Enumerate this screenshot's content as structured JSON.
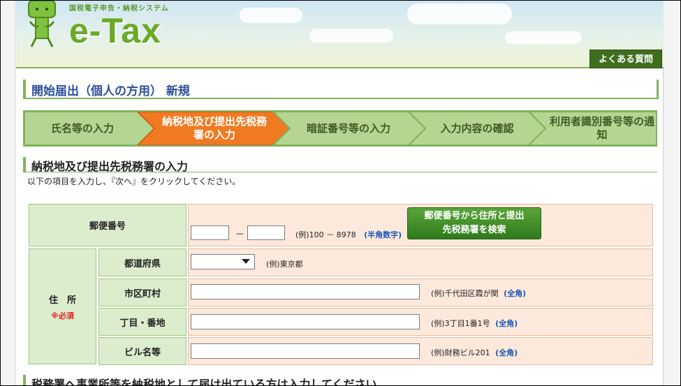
{
  "header": {
    "logo_sub": "国税電子申告・納税システム",
    "logo_main": "e-Tax",
    "faq_label": "よくある質問"
  },
  "page_title": "開始届出（個人の方用） 新規",
  "steps": [
    {
      "label": "氏名等の入力",
      "active": false
    },
    {
      "label": "納税地及び提出先税務署の入力",
      "active": true
    },
    {
      "label": "暗証番号等の入力",
      "active": false
    },
    {
      "label": "入力内容の確認",
      "active": false
    },
    {
      "label": "利用者識別番号等の通知",
      "active": false
    }
  ],
  "section": {
    "heading": "納税地及び提出先税務署の入力",
    "instruction": "以下の項目を入力し、『次へ』をクリックしてください。"
  },
  "form": {
    "postal": {
      "label": "郵便番号",
      "dash": "－",
      "example": "(例)100 － 8978",
      "hint": "(半角数字)",
      "search_button": "郵便番号から住所と提出先税務署を検索"
    },
    "address": {
      "label": "住　所",
      "required": "※必須",
      "prefecture": {
        "label": "都道府県",
        "example": "(例)東京都",
        "selected": ""
      },
      "city": {
        "label": "市区町村",
        "example": "(例)千代田区霞が関",
        "hint": "(全角)",
        "value": ""
      },
      "street": {
        "label": "丁目・番地",
        "example": "(例)3丁目1番1号",
        "hint": "(全角)",
        "value": ""
      },
      "building": {
        "label": "ビル名等",
        "example": "(例)財務ビル201",
        "hint": "(全角)",
        "value": ""
      }
    }
  },
  "bottom_heading": "税務署へ事業所等を納税地として届け出ている方は入力してください。",
  "colors": {
    "accent_green": "#7fb35a",
    "step_active": "#f07a22",
    "title_blue": "#2d4f9c",
    "hint_blue": "#1a57b8",
    "required_red": "#e02020"
  }
}
